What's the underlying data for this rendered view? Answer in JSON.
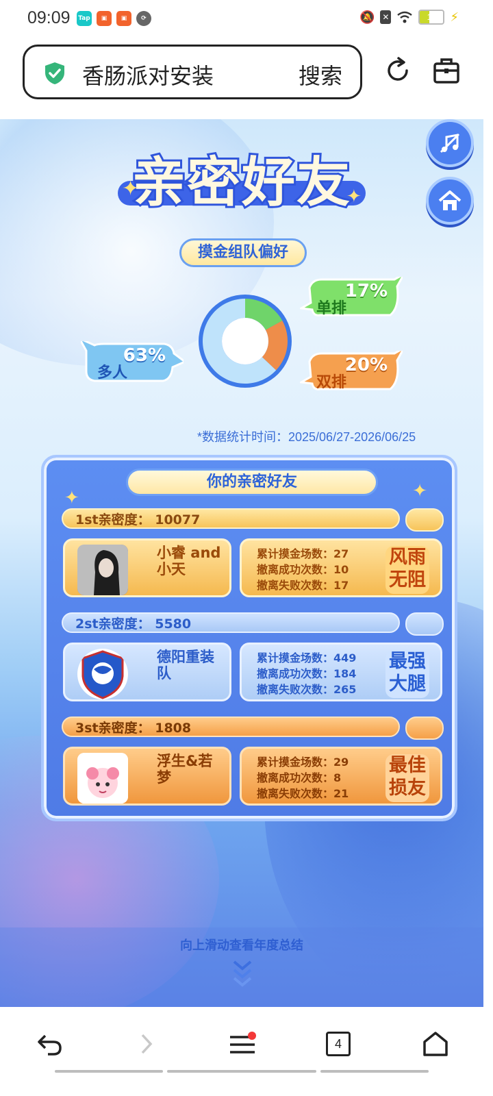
{
  "status_bar": {
    "time": "09:09",
    "battery": "13",
    "apps": [
      "Tap",
      "快手",
      "快手",
      "link"
    ]
  },
  "browser": {
    "search_query": "香肠派对安装",
    "search_button": "搜索",
    "icons": [
      "shield-check-icon",
      "reload-icon",
      "toolbox-icon"
    ]
  },
  "page": {
    "title": "亲密好友",
    "preference_title": "摸金组队偏好",
    "preference_chart": {
      "type": "pie",
      "categories": [
        "单排",
        "双排",
        "多人"
      ],
      "values": [
        17,
        20,
        63
      ],
      "labels": [
        "17%",
        "20%",
        "63%"
      ],
      "colors": [
        "#6fd46a",
        "#ee8d4a",
        "#bfe3fb"
      ]
    },
    "stat_period": "*数据统计时间：2025/06/27-2026/06/25",
    "friends_title": "你的亲密好友",
    "stat_labels": {
      "total": "累计摸金场数：",
      "success": "撤离成功次数：",
      "fail": "撤离失败次数："
    },
    "friends": [
      {
        "rank_label": "1st亲密度：  10077",
        "name": "小睿 and小天",
        "total": "27",
        "success": "10",
        "fail": "17",
        "badge": "风雨无阻"
      },
      {
        "rank_label": "2st亲密度：  5580",
        "name": "德阳重装队",
        "total": "449",
        "success": "184",
        "fail": "265",
        "badge": "最强大腿"
      },
      {
        "rank_label": "3st亲密度：  1808",
        "name": "浮生&若梦",
        "total": "29",
        "success": "8",
        "fail": "21",
        "badge": "最佳损友"
      }
    ],
    "swipe_hint": "向上滑动查看年度总结"
  },
  "bottom_nav": {
    "tab_count": "4",
    "icons": [
      "back-icon",
      "forward-icon",
      "menu-icon",
      "tabs-icon",
      "home-icon"
    ]
  }
}
